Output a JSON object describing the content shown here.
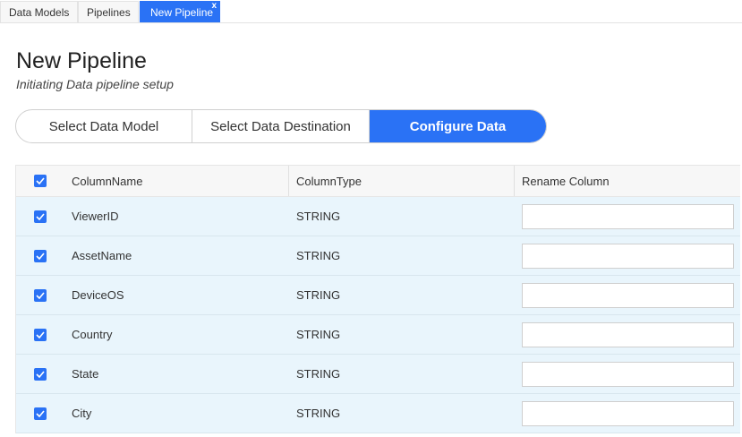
{
  "tabs": [
    {
      "label": "Data Models",
      "active": false
    },
    {
      "label": "Pipelines",
      "active": false
    },
    {
      "label": "New Pipeline",
      "active": true,
      "close": "x"
    }
  ],
  "header": {
    "title": "New Pipeline",
    "subtitle": "Initiating Data pipeline setup"
  },
  "stepper": {
    "steps": [
      "Select Data Model",
      "Select Data Destination",
      "Configure Data"
    ],
    "active_index": 2
  },
  "table": {
    "headers": {
      "name": "ColumnName",
      "type": "ColumnType",
      "rename": "Rename Column"
    },
    "header_checked": true,
    "rows": [
      {
        "name": "ViewerID",
        "type": "STRING",
        "checked": true,
        "rename": ""
      },
      {
        "name": "AssetName",
        "type": "STRING",
        "checked": true,
        "rename": ""
      },
      {
        "name": "DeviceOS",
        "type": "STRING",
        "checked": true,
        "rename": ""
      },
      {
        "name": "Country",
        "type": "STRING",
        "checked": true,
        "rename": ""
      },
      {
        "name": "State",
        "type": "STRING",
        "checked": true,
        "rename": ""
      },
      {
        "name": "City",
        "type": "STRING",
        "checked": true,
        "rename": ""
      }
    ]
  },
  "colors": {
    "accent": "#2a72f5",
    "row_bg": "#e9f5fc",
    "header_bg": "#f7f7f7"
  }
}
